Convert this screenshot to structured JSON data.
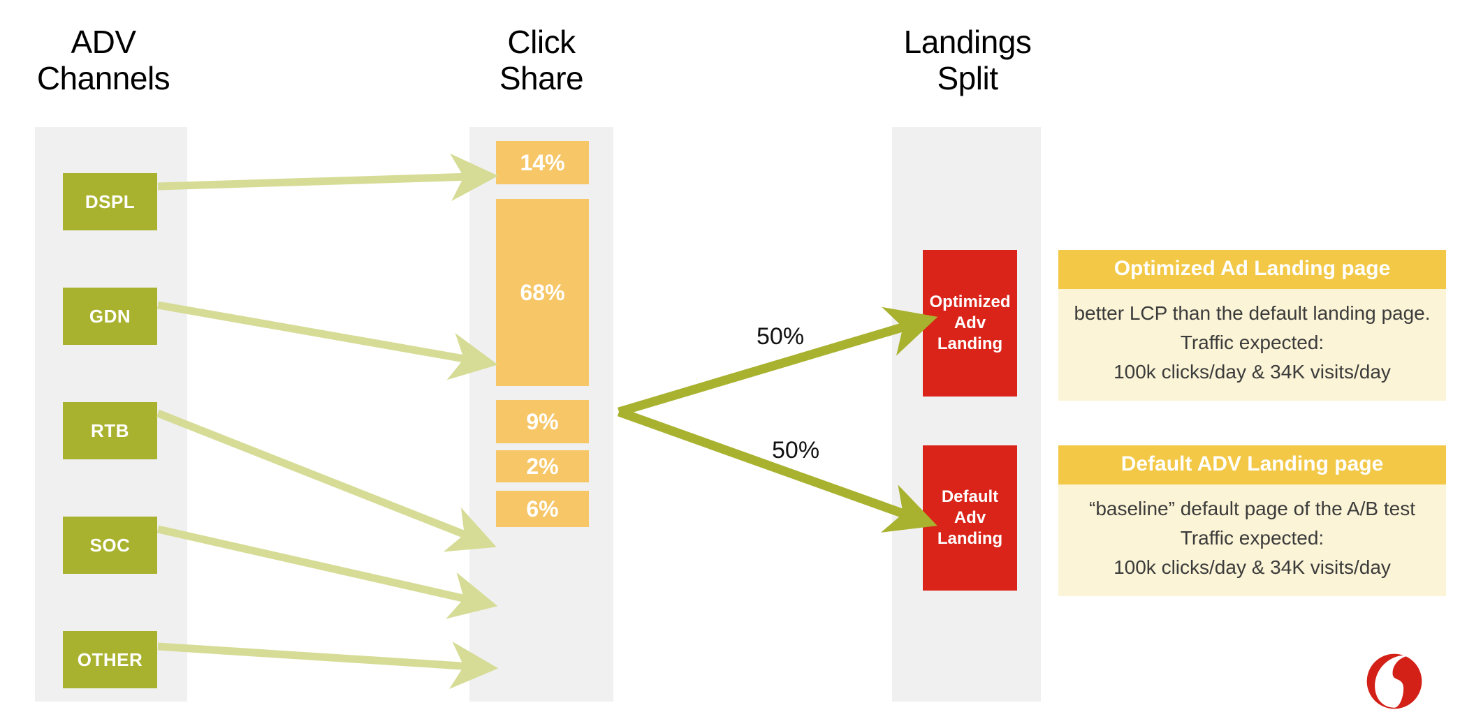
{
  "columns": [
    {
      "id": "adv",
      "title": "ADV\nChannels"
    },
    {
      "id": "click",
      "title": "Click\nShare"
    },
    {
      "id": "landings",
      "title": "Landings\nSplit"
    }
  ],
  "adv_channels": [
    {
      "label": "DSPL"
    },
    {
      "label": "GDN"
    },
    {
      "label": "RTB"
    },
    {
      "label": "SOC"
    },
    {
      "label": "OTHER"
    }
  ],
  "click_share": [
    {
      "label": "14%",
      "value": 14
    },
    {
      "label": "68%",
      "value": 68
    },
    {
      "label": "9%",
      "value": 9
    },
    {
      "label": "2%",
      "value": 2
    },
    {
      "label": "6%",
      "value": 6
    }
  ],
  "landings": [
    {
      "line1": "Optimized",
      "line2": "Adv",
      "line3": "Landing",
      "split": "50%"
    },
    {
      "line1": "Default",
      "line2": "Adv",
      "line3": "Landing",
      "split": "50%"
    }
  ],
  "split_labels": {
    "top": "50%",
    "bottom": "50%"
  },
  "cards": [
    {
      "title": "Optimized Ad Landing page",
      "line1": "better LCP than the default landing page.",
      "line2": "Traffic expected:",
      "line3": "100k clicks/day  & 34K visits/day"
    },
    {
      "title": "Default ADV Landing page",
      "line1": "“baseline” default page of the A/B test",
      "line2": "Traffic expected:",
      "line3": "100k clicks/day  & 34K visits/day"
    }
  ],
  "brand": {
    "logo_name": "vodafone-logo",
    "logo_color": "#d32118"
  },
  "colors": {
    "channel_green": "#a9b22e",
    "share_orange": "#f6c667",
    "landing_red": "#da2319",
    "card_header": "#f2c846",
    "card_body": "#fbf4d6",
    "column_bg": "#f0f0f0",
    "arrow_light": "#d6dc95",
    "arrow_dark": "#a8b22e"
  },
  "chart_data": {
    "type": "bar",
    "title": "ADV Channels → Click Share → Landings Split",
    "categories": [
      "DSPL",
      "GDN",
      "RTB",
      "SOC",
      "OTHER"
    ],
    "values": [
      14,
      68,
      9,
      2,
      6
    ],
    "value_labels": [
      "14%",
      "68%",
      "9%",
      "2%",
      "6%"
    ],
    "xlabel": "ADV Channels",
    "ylabel": "Click Share",
    "ylim": [
      0,
      100
    ],
    "grid": false,
    "legend": "none",
    "flow": {
      "stage1": "ADV Channels",
      "stage2": "Click Share",
      "stage3": "Landings Split",
      "links": [
        {
          "from": "DSPL",
          "to": "14%"
        },
        {
          "from": "GDN",
          "to": "68%"
        },
        {
          "from": "RTB",
          "to": "9%"
        },
        {
          "from": "SOC",
          "to": "2%"
        },
        {
          "from": "OTHER",
          "to": "6%"
        }
      ],
      "split": [
        {
          "to": "Optimized Adv Landing",
          "value": 50,
          "label": "50%"
        },
        {
          "to": "Default Adv Landing",
          "value": 50,
          "label": "50%"
        }
      ]
    }
  }
}
